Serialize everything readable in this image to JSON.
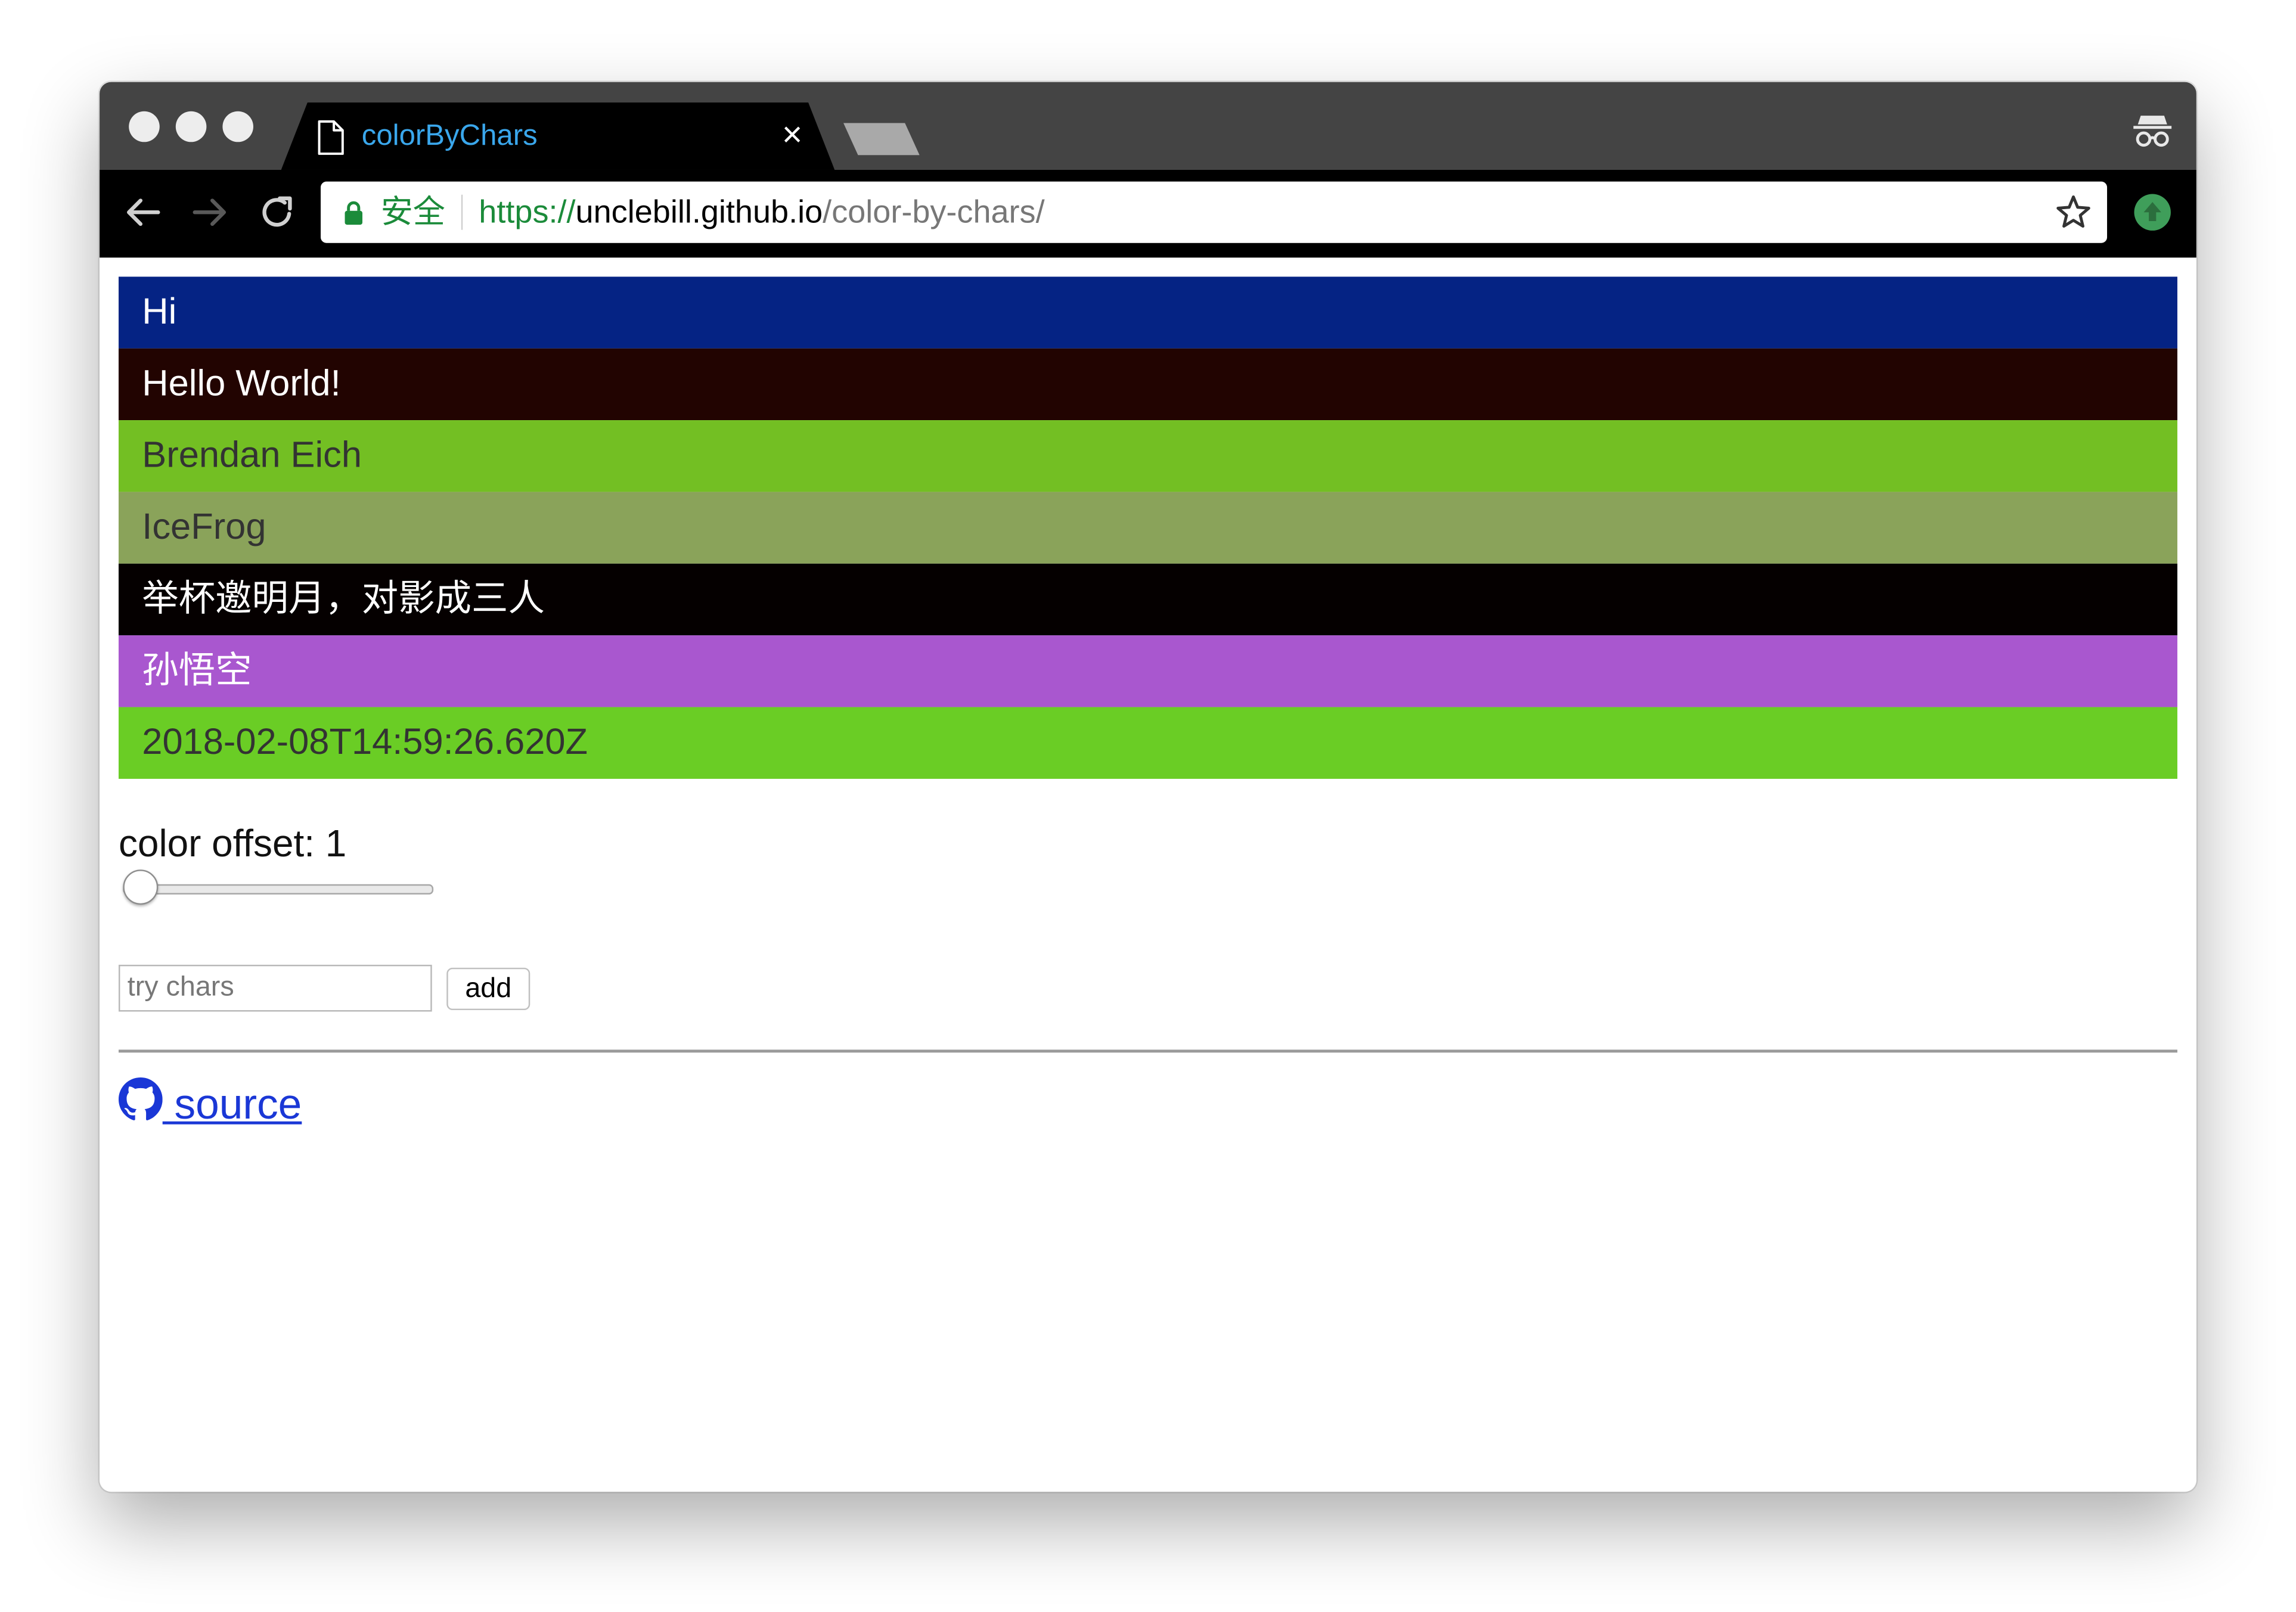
{
  "browser": {
    "tab_title": "colorByChars",
    "tab_close": "×",
    "security_label": "安全",
    "url_scheme": "https://",
    "url_host": "unclebill.github.io",
    "url_path": "/color-by-chars/"
  },
  "rows": [
    {
      "text": "Hi",
      "bg": "#052384",
      "fg": "#ffffff"
    },
    {
      "text": "Hello World!",
      "bg": "#220401",
      "fg": "#ffffff"
    },
    {
      "text": "Brendan Eich",
      "bg": "#73bf23",
      "fg": "#333333"
    },
    {
      "text": "IceFrog",
      "bg": "#8aa35a",
      "fg": "#333333"
    },
    {
      "text": "举杯邀明月，对影成三人",
      "bg": "#050000",
      "fg": "#ffffff"
    },
    {
      "text": "孙悟空",
      "bg": "#a957cf",
      "fg": "#ffffff"
    },
    {
      "text": "2018-02-08T14:59:26.620Z",
      "bg": "#6acd25",
      "fg": "#333333"
    }
  ],
  "controls": {
    "offset_label": "color offset: 1",
    "offset_value": 1,
    "input_placeholder": "try chars",
    "input_value": "",
    "add_label": "add"
  },
  "footer": {
    "source_label": " source"
  },
  "icons": {
    "tab": "page-icon",
    "close": "close-icon",
    "incognito": "incognito-icon",
    "back": "back-arrow-icon",
    "forward": "forward-arrow-icon",
    "reload": "reload-icon",
    "lock": "lock-icon",
    "star": "star-icon",
    "extension": "extension-icon",
    "github": "github-icon"
  }
}
